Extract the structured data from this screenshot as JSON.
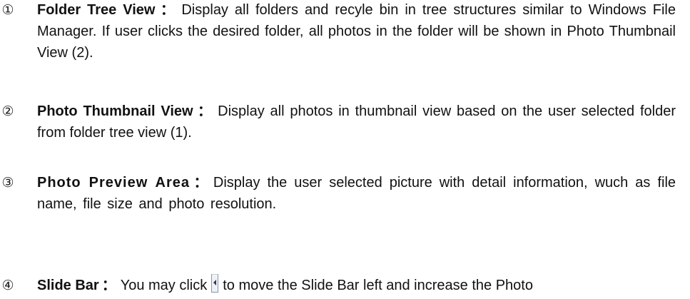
{
  "items": [
    {
      "number": "①",
      "title": "Folder Tree View",
      "separator": "：",
      "body": "Display all folders and recyle bin in tree structures similar to Windows File Manager. If user clicks the desired folder, all photos in the folder will be shown in Photo Thumbnail View (2)."
    },
    {
      "number": "②",
      "title": "Photo Thumbnail View",
      "separator": "：",
      "body": "Display all photos in thumbnail view based on the user selected folder from folder tree view (1)."
    },
    {
      "number": "③",
      "title": "Photo Preview Area",
      "separator": "：",
      "body": "Display the user selected picture with detail information, wuch as file name, file size and photo resolution."
    },
    {
      "number": "④",
      "title": "Slide Bar",
      "separator": "：",
      "body_before": "You may click",
      "icon": "slide-left-arrow-icon",
      "body_after": "to move the Slide Bar left and increase the Photo"
    }
  ]
}
